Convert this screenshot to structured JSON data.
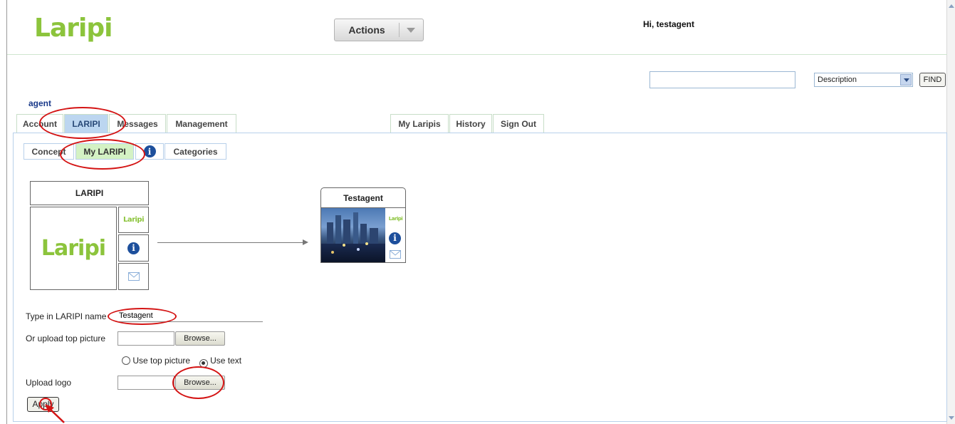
{
  "header": {
    "logo_text": "Laripi",
    "actions_label": "Actions",
    "greeting": "Hi, testagent"
  },
  "search": {
    "value": "",
    "filter_selected": "Description",
    "find_label": "FIND"
  },
  "user_label": "agent",
  "main_tabs": {
    "left": [
      {
        "label": "Account",
        "active": false
      },
      {
        "label": "LARIPI",
        "active": true
      },
      {
        "label": "Messages",
        "active": false
      },
      {
        "label": "Management",
        "active": false
      }
    ],
    "right": [
      {
        "label": "My Laripis"
      },
      {
        "label": "History"
      },
      {
        "label": "Sign Out"
      }
    ]
  },
  "sub_tabs": [
    {
      "label": "Concept",
      "active": false
    },
    {
      "label": "My LARIPI",
      "active": true
    },
    {
      "label": "Categories",
      "active": false
    }
  ],
  "preview": {
    "template_title": "LARIPI",
    "result_title": "Testagent"
  },
  "form": {
    "name_label": "Type in LARIPI name",
    "name_value": "Testagent",
    "top_picture_label": "Or upload top picture",
    "browse_label": "Browse...",
    "radio_top_picture": "Use top picture",
    "radio_text": "Use text",
    "radio_selected": "text",
    "logo_label": "Upload logo",
    "apply_label": "Apply"
  },
  "colors": {
    "brand_green": "#8cc43c",
    "active_tab": "#bcd6f0",
    "active_subtab": "#d4f2c4",
    "annotation_red": "#d41414"
  }
}
